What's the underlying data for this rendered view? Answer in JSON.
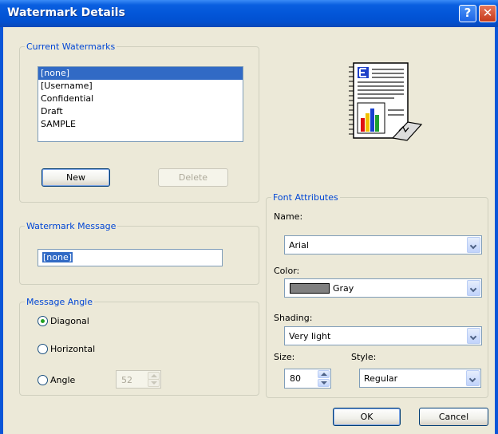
{
  "window": {
    "title": "Watermark Details",
    "help_glyph": "?",
    "close_glyph": "✕"
  },
  "current_watermarks": {
    "legend": "Current Watermarks",
    "items": [
      "[none]",
      "[Username]",
      "Confidential",
      "Draft",
      "SAMPLE"
    ],
    "selected": "[none]",
    "new_label": "New",
    "delete_label": "Delete"
  },
  "watermark_message": {
    "legend": "Watermark Message",
    "value": "[none]"
  },
  "message_angle": {
    "legend": "Message Angle",
    "diagonal_label": "Diagonal",
    "horizontal_label": "Horizontal",
    "angle_label": "Angle",
    "angle_value": "52",
    "selected": "Diagonal"
  },
  "font_attributes": {
    "legend": "Font Attributes",
    "name_label": "Name:",
    "name_value": "Arial",
    "color_label": "Color:",
    "color_value": "Gray",
    "color_swatch": "#808080",
    "shading_label": "Shading:",
    "shading_value": "Very light",
    "size_label": "Size:",
    "size_value": "80",
    "style_label": "Style:",
    "style_value": "Regular"
  },
  "footer": {
    "ok_label": "OK",
    "cancel_label": "Cancel"
  },
  "colors": {
    "title_bar": "#0a5fe0",
    "legend_text": "#0046d5",
    "selection": "#316ac5",
    "dialog_bg": "#ece9d8"
  },
  "icons": {
    "preview": "document-chart-preview-icon"
  }
}
